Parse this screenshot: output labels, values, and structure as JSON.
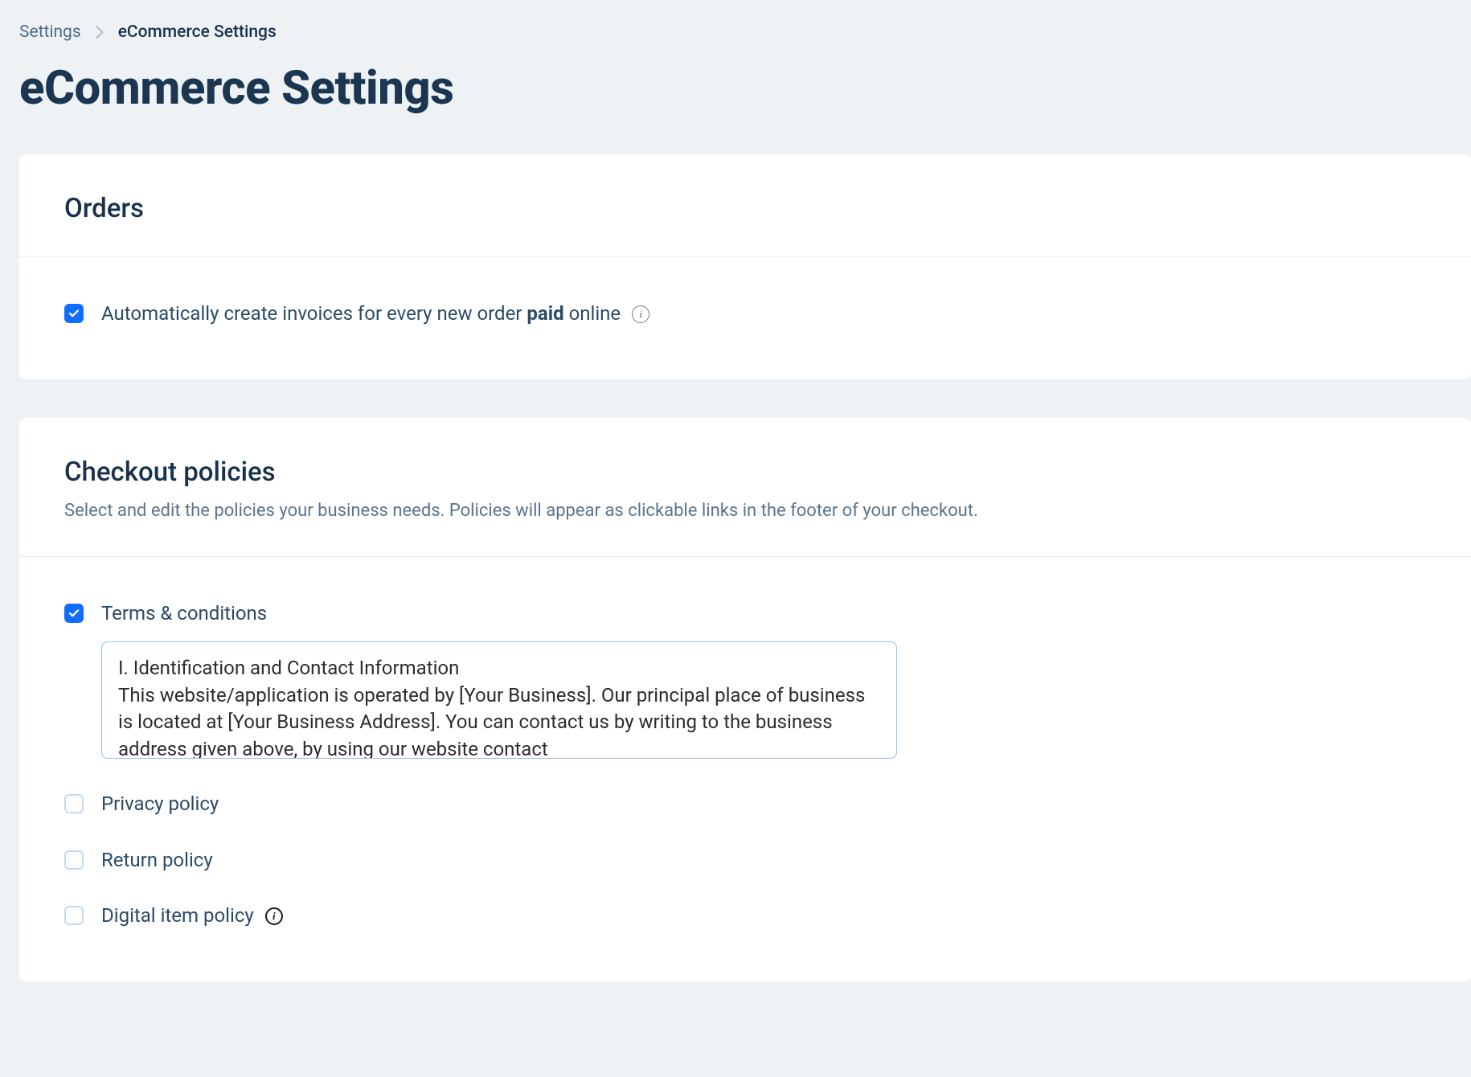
{
  "breadcrumb": {
    "root": "Settings",
    "current": "eCommerce Settings"
  },
  "page_title": "eCommerce Settings",
  "orders": {
    "title": "Orders",
    "auto_invoice": {
      "checked": true,
      "label_prefix": "Automatically create invoices for every new order ",
      "label_bold": "paid",
      "label_suffix": " online"
    }
  },
  "checkout_policies": {
    "title": "Checkout policies",
    "subtitle": "Select and edit the policies your business needs. Policies will appear as clickable links in the footer of your checkout.",
    "items": [
      {
        "key": "terms",
        "label": "Terms & conditions",
        "checked": true,
        "has_info": false,
        "text": "I. Identification and Contact Information\nThis website/application is operated by [Your Business]. Our principal place of business is located at [Your Business Address]. You can contact us by writing to the business address given above, by using our website contact"
      },
      {
        "key": "privacy",
        "label": "Privacy policy",
        "checked": false,
        "has_info": false
      },
      {
        "key": "return",
        "label": "Return policy",
        "checked": false,
        "has_info": false
      },
      {
        "key": "digital",
        "label": "Digital item policy",
        "checked": false,
        "has_info": true
      }
    ]
  }
}
